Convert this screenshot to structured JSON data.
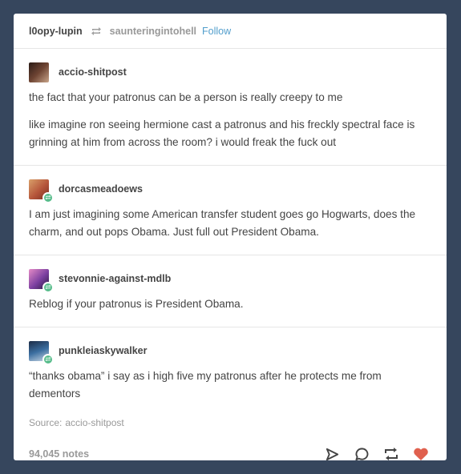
{
  "header": {
    "username": "l0opy-lupin",
    "reblogged_from": "saunteringintohell",
    "follow_label": "Follow"
  },
  "posts": [
    {
      "username": "accio-shitpost",
      "avatar_color": "#5a3a2e",
      "paragraphs": [
        "the fact that your patronus can be a person is really creepy to me",
        "like imagine ron seeing hermione cast a patronus and his freckly spectral face is grinning at him from across the room? i would freak the fuck out"
      ]
    },
    {
      "username": "dorcasmeadoews",
      "avatar_color": "#b5553a",
      "paragraphs": [
        "I am just imagining some American transfer student goes go Hogwarts, does the charm, and out pops Obama. Just full out President Obama."
      ]
    },
    {
      "username": "stevonnie-against-mdlb",
      "avatar_color": "#7a3fa0",
      "paragraphs": [
        "Reblog if your patronus is President Obama."
      ]
    },
    {
      "username": "punkleiaskywalker",
      "avatar_color": "#2d4a6e",
      "paragraphs": [
        "“thanks obama” i say as i high five my patronus after he protects me from dementors"
      ]
    }
  ],
  "source": {
    "label": "Source:",
    "name": "accio-shitpost"
  },
  "footer": {
    "notes": "94,045 notes"
  },
  "colors": {
    "background": "#36465d",
    "link": "#529ecc",
    "reblog_badge": "#56bc8a",
    "like": "#e0604e"
  }
}
